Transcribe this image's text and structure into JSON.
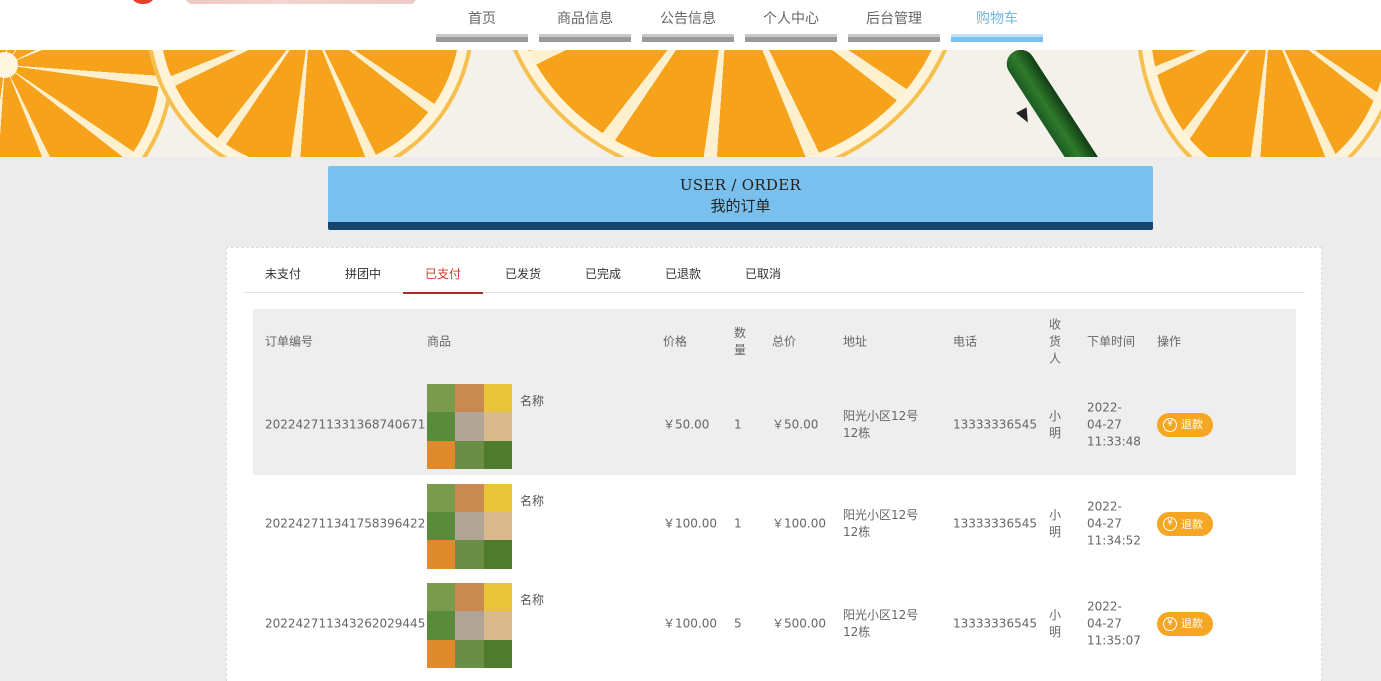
{
  "nav": {
    "items": [
      {
        "label": "首页",
        "active": false
      },
      {
        "label": "商品信息",
        "active": false
      },
      {
        "label": "公告信息",
        "active": false
      },
      {
        "label": "个人中心",
        "active": false
      },
      {
        "label": "后台管理",
        "active": false
      },
      {
        "label": "购物车",
        "active": true
      }
    ]
  },
  "header": {
    "title_en": "USER / ORDER",
    "title_cn": "我的订单"
  },
  "tabs": [
    {
      "label": "未支付",
      "active": false
    },
    {
      "label": "拼团中",
      "active": false
    },
    {
      "label": "已支付",
      "active": true
    },
    {
      "label": "已发货",
      "active": false
    },
    {
      "label": "已完成",
      "active": false
    },
    {
      "label": "已退款",
      "active": false
    },
    {
      "label": "已取消",
      "active": false
    }
  ],
  "table": {
    "columns": {
      "order_no": "订单编号",
      "goods": "商品",
      "price": "价格",
      "qty": "数量",
      "total": "总价",
      "address": "地址",
      "phone": "电话",
      "receiver": "收货人",
      "time": "下单时间",
      "op": "操作"
    },
    "rows": [
      {
        "order_no": "202242711331368740671",
        "goods_name": "名称",
        "price": "￥50.00",
        "qty": "1",
        "total": "￥50.00",
        "address": "阳光小区12号12栋",
        "phone": "13333336545",
        "receiver": "小明",
        "time": "2022-04-27 11:33:48",
        "op_label": "退款"
      },
      {
        "order_no": "202242711341758396422",
        "goods_name": "名称",
        "price": "￥100.00",
        "qty": "1",
        "total": "￥100.00",
        "address": "阳光小区12号12栋",
        "phone": "13333336545",
        "receiver": "小明",
        "time": "2022-04-27 11:34:52",
        "op_label": "退款"
      },
      {
        "order_no": "202242711343262029445",
        "goods_name": "名称",
        "price": "￥100.00",
        "qty": "5",
        "total": "￥500.00",
        "address": "阳光小区12号12栋",
        "phone": "13333336545",
        "receiver": "小明",
        "time": "2022-04-27 11:35:07",
        "op_label": "退款"
      }
    ]
  },
  "colors": {
    "accent": "#7ac0ef",
    "header_underline": "#16446b",
    "active_tab": "#d0392b",
    "refund_button": "#f5a623"
  },
  "icons": {
    "refund": "yen-icon"
  }
}
